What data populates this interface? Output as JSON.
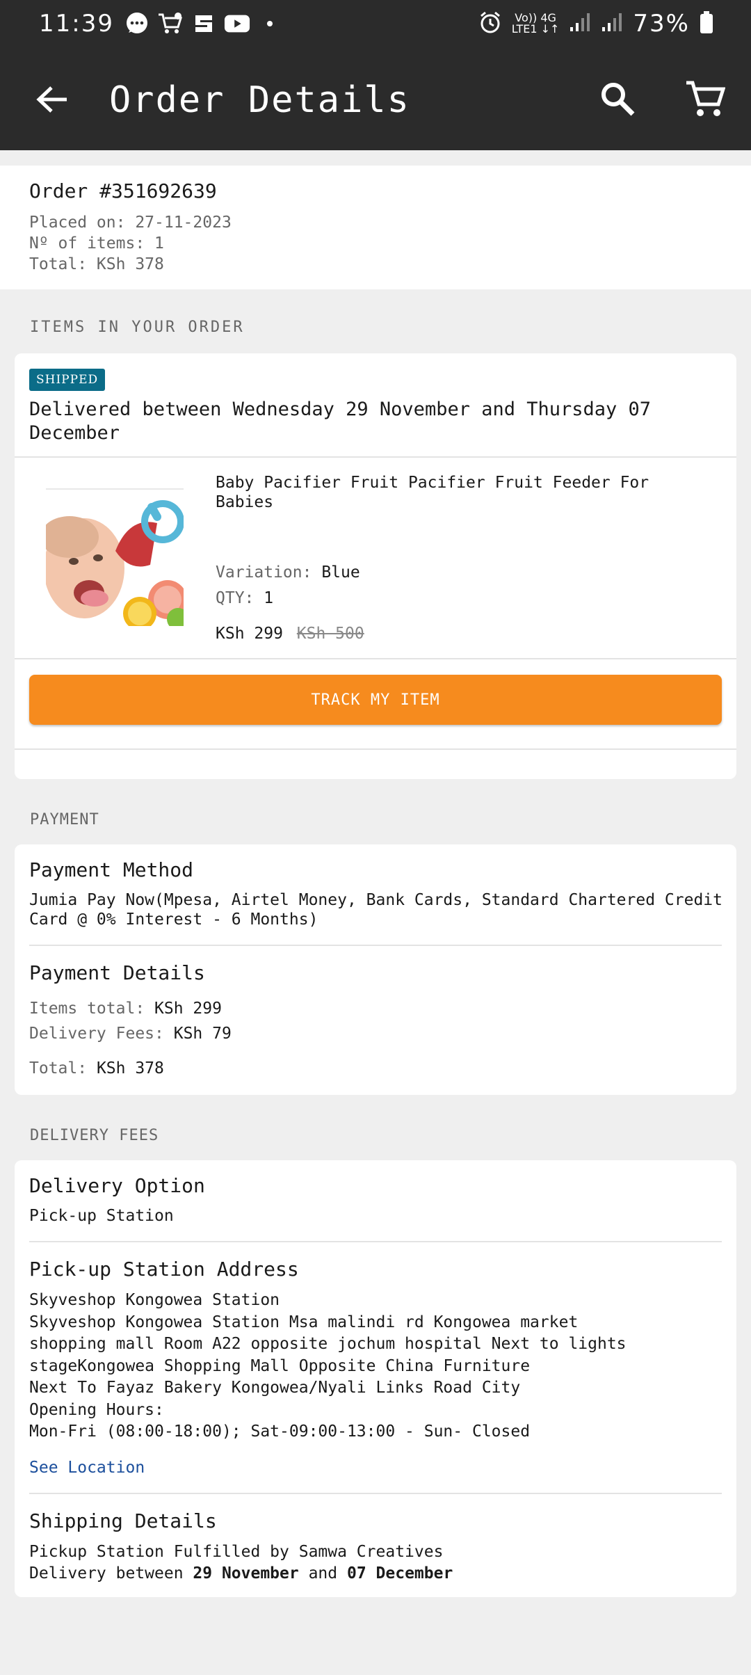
{
  "status_bar": {
    "time": "11:39",
    "left_icons": [
      "chat-icon",
      "cart-icon",
      "app-icon",
      "youtube-icon"
    ],
    "network_top": "Vo)) 4G",
    "network_bottom": "LTE1 ↓↑",
    "battery": "73%"
  },
  "app_bar": {
    "title": "Order Details"
  },
  "order": {
    "number": "Order #351692639",
    "placed_on": "Placed on: 27-11-2023",
    "items_count": "Nº of items: 1",
    "total": "Total: KSh 378"
  },
  "items_section": {
    "label": "ITEMS IN YOUR ORDER",
    "badge": "SHIPPED",
    "delivery_text": "Delivered between Wednesday 29 November and Thursday 07 December",
    "product": {
      "name": "Baby Pacifier Fruit Pacifier Fruit Feeder For Babies",
      "variation_label": "Variation: ",
      "variation_value": "Blue",
      "qty_label": "QTY: ",
      "qty_value": "1",
      "price": "KSh 299",
      "old_price": "KSh 500"
    },
    "track_button": "TRACK MY ITEM"
  },
  "payment_section": {
    "label": "PAYMENT",
    "method_title": "Payment Method",
    "method_text": "Jumia Pay Now(Mpesa, Airtel Money, Bank Cards, Standard Chartered Credit Card @ 0% Interest - 6 Months)",
    "details_title": "Payment Details",
    "items_total_label": "Items total: ",
    "items_total_value": "KSh 299",
    "delivery_fees_label": "Delivery Fees: ",
    "delivery_fees_value": "KSh 79",
    "total_label": "Total: ",
    "total_value": "KSh 378"
  },
  "delivery_section": {
    "label": "DELIVERY FEES",
    "option_title": "Delivery Option",
    "option_value": "Pick-up Station",
    "address_title": "Pick-up Station Address",
    "station_name": "Skyveshop Kongowea Station",
    "address_lines": [
      "Skyveshop Kongowea Station Msa malindi rd Kongowea market",
      "shopping mall Room A22 opposite jochum hospital Next to lights",
      "stageKongowea Shopping Mall Opposite China Furniture",
      "Next To Fayaz Bakery Kongowea/Nyali Links Road City"
    ],
    "opening_hours_label": "Opening Hours:",
    "opening_hours": "Mon-Fri (08:00-18:00); Sat-09:00-13:00 - Sun-  Closed",
    "see_location": "See Location",
    "shipping_title": "Shipping Details",
    "fulfilled_by": "Pickup Station Fulfilled by Samwa Creatives",
    "delivery_prefix": "Delivery between ",
    "delivery_start": "29 November",
    "delivery_and": " and ",
    "delivery_end": "07 December"
  },
  "colors": {
    "app_bar": "#2b2b2b",
    "accent_orange": "#f68b1e",
    "badge_blue": "#0b6c88",
    "link_blue": "#1c4f9c"
  }
}
